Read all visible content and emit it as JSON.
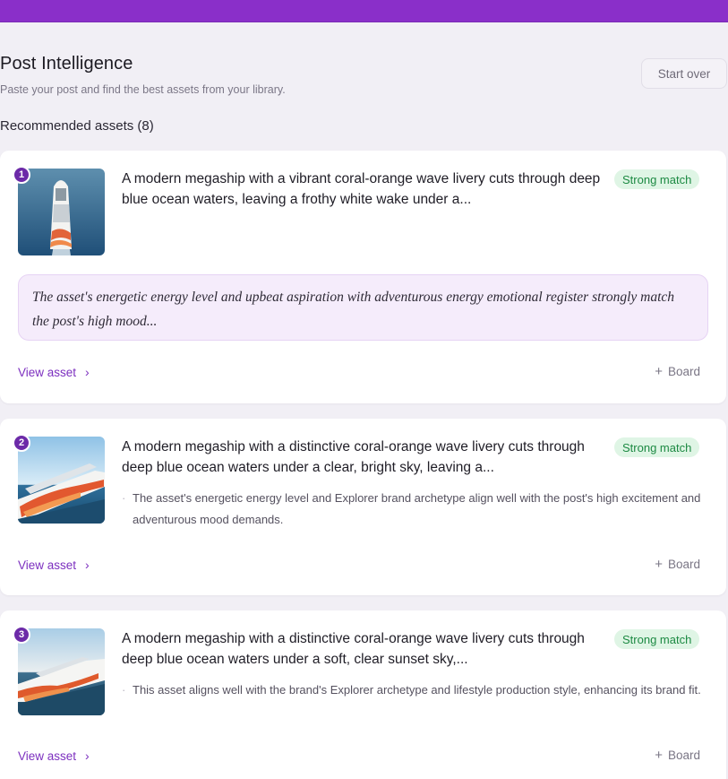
{
  "page": {
    "title": "Post Intelligence",
    "subtitle": "Paste your post and find the best assets from your library.",
    "start_over_label": "Start over",
    "section_heading": "Recommended assets (8)"
  },
  "cards": [
    {
      "rank": "1",
      "title": "A modern megaship with a vibrant coral-orange wave livery cuts through deep blue ocean waters, leaving a frothy white wake under a...",
      "match": "Strong match",
      "quote": "The asset's energetic energy level and upbeat aspiration with adventurous energy emotional register strongly match the post's high mood...",
      "view_label": "View asset",
      "board_label": "Board"
    },
    {
      "rank": "2",
      "title": "A modern megaship with a distinctive coral-orange wave livery cuts through deep blue ocean waters under a clear, bright sky, leaving a...",
      "match": "Strong match",
      "reason": "The asset's energetic energy level and Explorer brand archetype align well with the post's high excitement and adventurous mood demands.",
      "view_label": "View asset",
      "board_label": "Board"
    },
    {
      "rank": "3",
      "title": "A modern megaship with a distinctive coral-orange wave livery cuts through deep blue ocean waters under a soft, clear sunset sky,...",
      "match": "Strong match",
      "reason": "This asset aligns well with the brand's Explorer archetype and lifestyle production style, enhancing its brand fit.",
      "view_label": "View asset",
      "board_label": "Board"
    }
  ],
  "colors": {
    "brand_purple": "#8a2fc9",
    "link_purple": "#7c2fbf",
    "match_green": "#1d8a43",
    "match_bg": "#dff5e5"
  },
  "icons": {
    "view_chevron": "chevron-right-icon",
    "board_plus": "plus-icon"
  }
}
